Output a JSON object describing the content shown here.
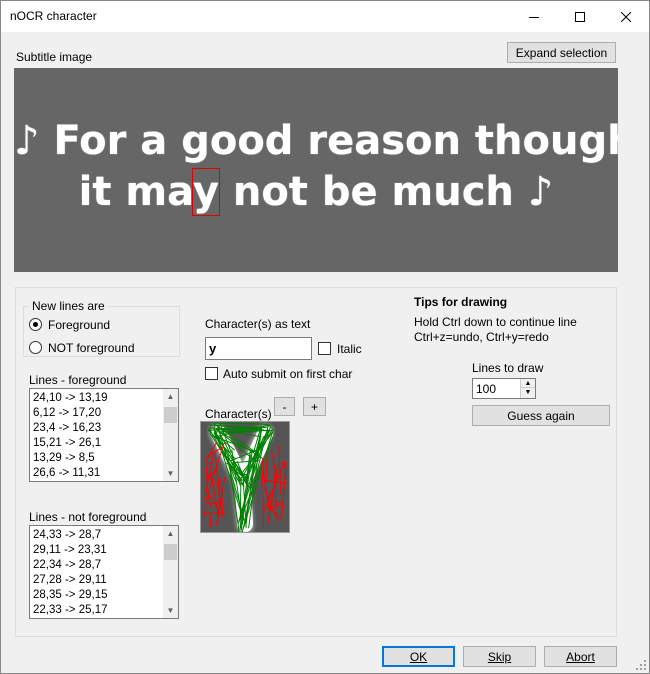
{
  "window": {
    "title": "nOCR character",
    "controls": {
      "minimize": "minimize-icon",
      "maximize": "maximize-icon",
      "close": "close-icon"
    }
  },
  "subtitle": {
    "label": "Subtitle image",
    "expand_label": "Expand selection",
    "line1": "♪ For a good reason though",
    "line2_before": "it ma",
    "line2_highlight": "y",
    "line2_after": " not be much ♪"
  },
  "new_lines": {
    "group_label": "New lines are",
    "foreground": "Foreground",
    "not_foreground": "NOT foreground",
    "selected": "foreground"
  },
  "lines_foreground": {
    "label": "Lines - foreground",
    "items": [
      "24,10 -> 13,19",
      "6,12 -> 17,20",
      "23,4 -> 16,23",
      "15,21 -> 26,1",
      "13,29 -> 8,5",
      "26,6 -> 11,31"
    ]
  },
  "lines_not_foreground": {
    "label": "Lines - not foreground",
    "items": [
      "24,33 -> 28,7",
      "29,11 -> 23,31",
      "22,34 -> 28,7",
      "27,28 -> 29,11",
      "28,35 -> 29,15",
      "22,33 -> 25,17"
    ]
  },
  "character": {
    "text_label": "Character(s) as text",
    "text_value": "y",
    "italic_label": "Italic",
    "italic_checked": false,
    "auto_submit_label": "Auto submit on first char",
    "auto_submit_checked": false,
    "image_label": "Character(s)",
    "minus_label": "-",
    "plus_label": "+"
  },
  "tips": {
    "title": "Tips for drawing",
    "line1": "Hold Ctrl down to continue line",
    "line2": "Ctrl+z=undo, Ctrl+y=redo"
  },
  "lines_to_draw": {
    "label": "Lines to draw",
    "value": "100",
    "guess_label": "Guess again"
  },
  "footer": {
    "ok_label": "OK",
    "skip_label": "Skip",
    "abort_label": "Abort"
  },
  "colors": {
    "foreground_line": "#008000",
    "not_foreground_line": "#ff0000",
    "subtitle_bg": "#666666",
    "highlight": "#dd0000"
  }
}
